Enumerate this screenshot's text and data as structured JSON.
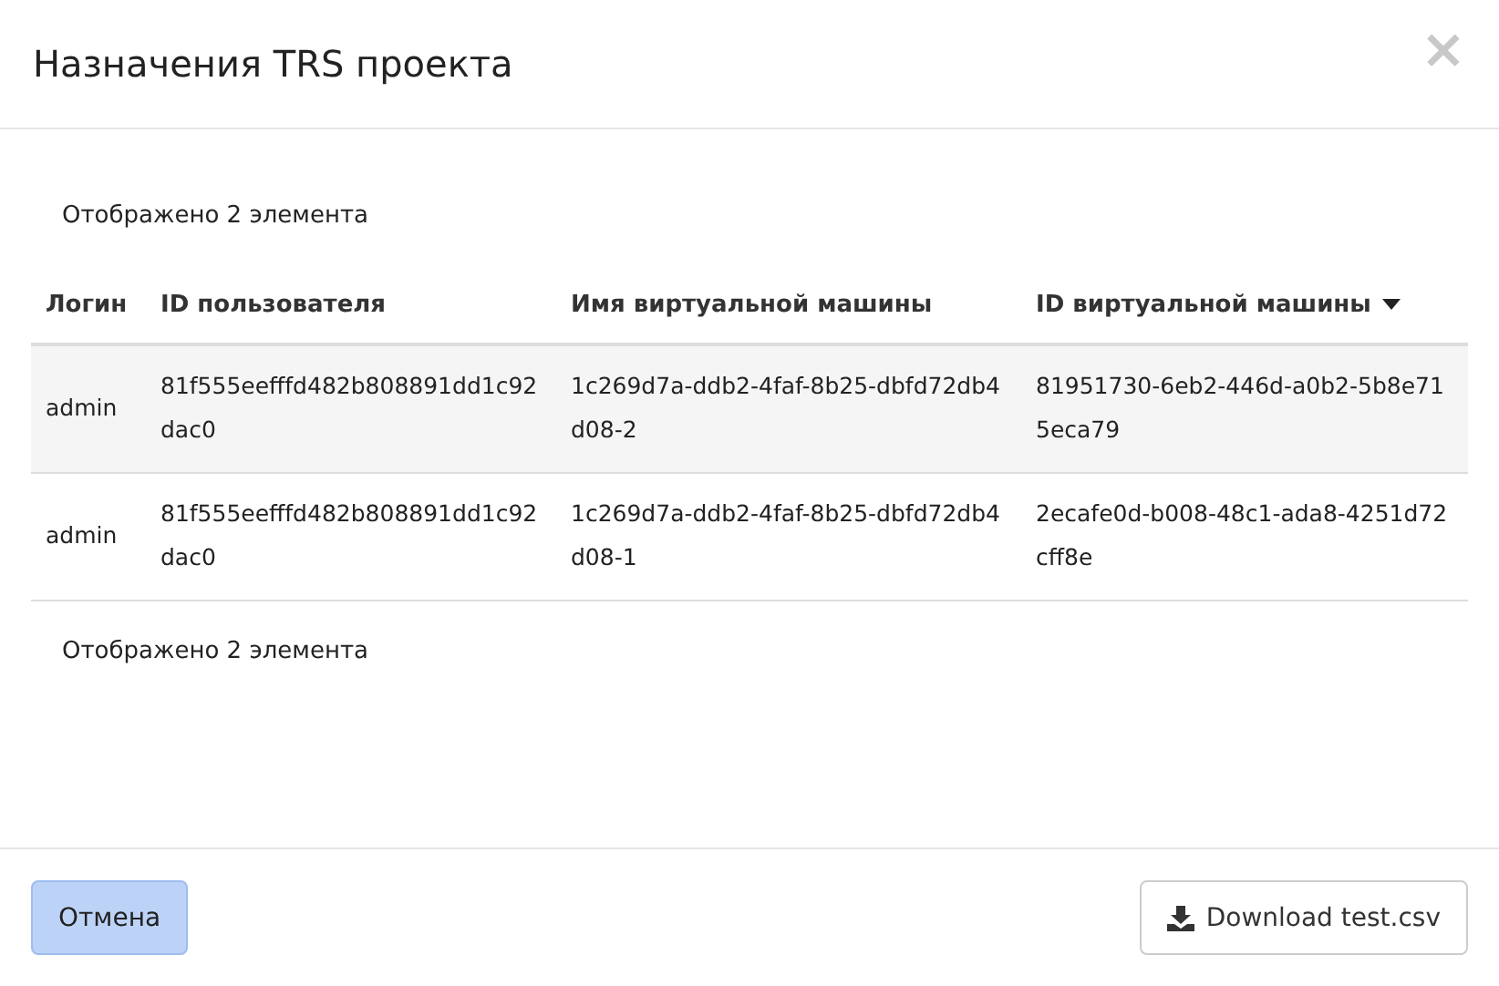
{
  "dialog": {
    "title": "Назначения TRS проекта",
    "close_label": "×"
  },
  "summary_top": "Отображено 2 элемента",
  "table": {
    "columns": [
      {
        "label": "Логин",
        "sorted": false
      },
      {
        "label": "ID пользователя",
        "sorted": false
      },
      {
        "label": "Имя виртуальной машины",
        "sorted": false
      },
      {
        "label": "ID виртуальной машины",
        "sorted": true
      }
    ],
    "rows": [
      [
        "admin",
        "81f555eefffd482b808891dd1c92dac0",
        "1c269d7a-ddb2-4faf-8b25-dbfd72db4d08-2",
        "81951730-6eb2-446d-a0b2-5b8e715eca79"
      ],
      [
        "admin",
        "81f555eefffd482b808891dd1c92dac0",
        "1c269d7a-ddb2-4faf-8b25-dbfd72db4d08-1",
        "2ecafe0d-b008-48c1-ada8-4251d72cff8e"
      ]
    ]
  },
  "summary_bottom": "Отображено 2 элемента",
  "footer": {
    "cancel": "Отмена",
    "download": "Download test.csv"
  }
}
